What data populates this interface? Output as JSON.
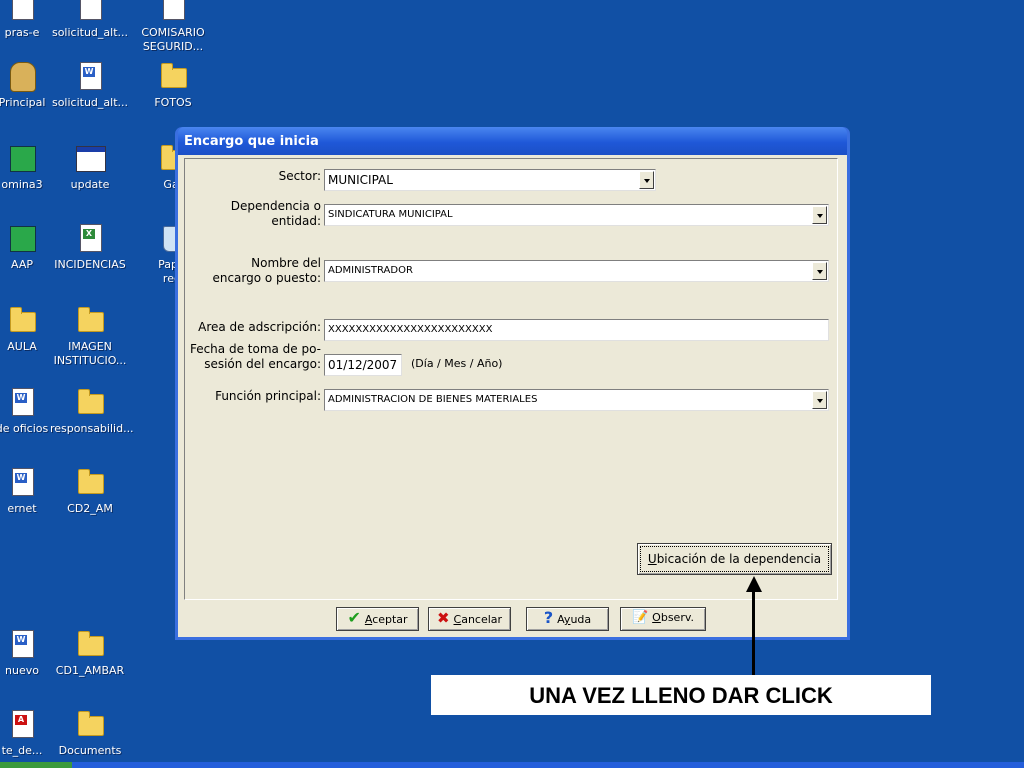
{
  "desktop": {
    "icons": [
      {
        "label": "pras-e",
        "type": "doc"
      },
      {
        "label": "solicitud_alt...",
        "type": "doc"
      },
      {
        "label": "COMISARIO\nSEGURID...",
        "type": "doc"
      },
      {
        "label": "Principal",
        "type": "seal"
      },
      {
        "label": "solicitud_alt...",
        "type": "word"
      },
      {
        "label": "FOTOS",
        "type": "folder"
      },
      {
        "label": "omina3",
        "type": "app"
      },
      {
        "label": "update",
        "type": "window"
      },
      {
        "label": "Gaf",
        "type": "folder"
      },
      {
        "label": "AAP",
        "type": "app"
      },
      {
        "label": "INCIDENCIAS",
        "type": "excel"
      },
      {
        "label": "Papel\nreci",
        "type": "recycle"
      },
      {
        "label": "AULA",
        "type": "folder"
      },
      {
        "label": "IMAGEN\nINSTITUCIO...",
        "type": "folder"
      },
      {
        "label": "de oficios",
        "type": "word"
      },
      {
        "label": "responsabilid...",
        "type": "folder"
      },
      {
        "label": "ernet",
        "type": "word"
      },
      {
        "label": "CD2_AM",
        "type": "folder"
      },
      {
        "label": "nuevo",
        "type": "word"
      },
      {
        "label": "CD1_AMBAR",
        "type": "folder"
      },
      {
        "label": "te_de...",
        "type": "pdf"
      },
      {
        "label": "Documents",
        "type": "folder"
      }
    ]
  },
  "dialog": {
    "title": "Encargo que inicia",
    "sector": {
      "label": "Sector:",
      "value": "MUNICIPAL"
    },
    "dependencia": {
      "label_line1": "Dependencia o",
      "label_line2": "entidad:",
      "value": "SINDICATURA MUNICIPAL"
    },
    "nombre": {
      "label_line1": "Nombre del",
      "label_line2": "encargo o puesto:",
      "value": "ADMINISTRADOR"
    },
    "area": {
      "label": "Area de adscripción:",
      "value": "XXXXXXXXXXXXXXXXXXXXXXXX"
    },
    "fecha": {
      "label_line1": "Fecha de toma de po-",
      "label_line2": "sesión del encargo:",
      "value": "01/12/2007",
      "hint": "(Día / Mes / Año)"
    },
    "funcion": {
      "label": "Función principal:",
      "value": "ADMINISTRACION DE BIENES MATERIALES"
    },
    "ubicacion_button": {
      "accel": "U",
      "rest": "bicación de la dependencia"
    },
    "buttons": {
      "aceptar": {
        "accel": "A",
        "rest": "ceptar"
      },
      "cancelar": {
        "accel": "C",
        "rest": "ancelar"
      },
      "ayuda_pre": "A",
      "ayuda_accel": "y",
      "ayuda_rest": "uda",
      "observ": {
        "accel": "O",
        "rest": "bserv."
      }
    }
  },
  "annotation": {
    "text": "UNA VEZ LLENO DAR CLICK"
  }
}
